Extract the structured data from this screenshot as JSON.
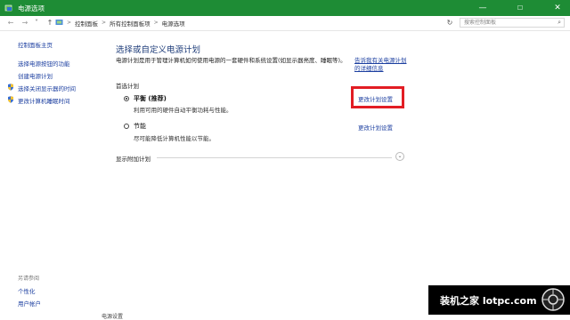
{
  "window": {
    "title": "电源选项",
    "controls": {
      "minimize": "—",
      "maximize": "☐",
      "close": "✕"
    }
  },
  "addressbar": {
    "back": "←",
    "forward": "→",
    "dropdown": "˅",
    "up": "↑",
    "breadcrumb": [
      "控制面板",
      "所有控制面板项",
      "电源选项"
    ],
    "separator": ">",
    "refresh": "↻",
    "search_placeholder": "搜索控制面板",
    "search_icon": "⌕"
  },
  "sidebar": {
    "home": "控制面板主页",
    "links": [
      "选择电源按钮的功能",
      "创建电源计划",
      "选择关闭显示器的时间",
      "更改计算机睡眠时间"
    ],
    "see_also_title": "另请参阅",
    "see_also": [
      "个性化",
      "用户帐户"
    ]
  },
  "main": {
    "heading": "选择或自定义电源计划",
    "description": "电源计划是用于管理计算机如何使用电源的一套硬件和系统设置(如显示器亮度、睡眠等)。",
    "more_link": "告诉我有关电源计划的详细信息",
    "preferred_label": "首选计划",
    "plans": [
      {
        "name": "平衡 (推荐)",
        "desc": "利用可用的硬件自动平衡功耗与性能。",
        "change": "更改计划设置",
        "selected": true
      },
      {
        "name": "节能",
        "desc": "尽可能降低计算机性能以节能。",
        "change": "更改计划设置",
        "selected": false
      }
    ],
    "show_more": "显示附加计划",
    "expander_icon": "⌄"
  },
  "taskbar_peek": "电源设置",
  "watermark": {
    "text": "装机之家 lotpc.com"
  },
  "colors": {
    "titlebar": "#1e8c35",
    "link": "#1c3fa0",
    "heading": "#1f3d7a",
    "highlight": "#e21d24"
  }
}
